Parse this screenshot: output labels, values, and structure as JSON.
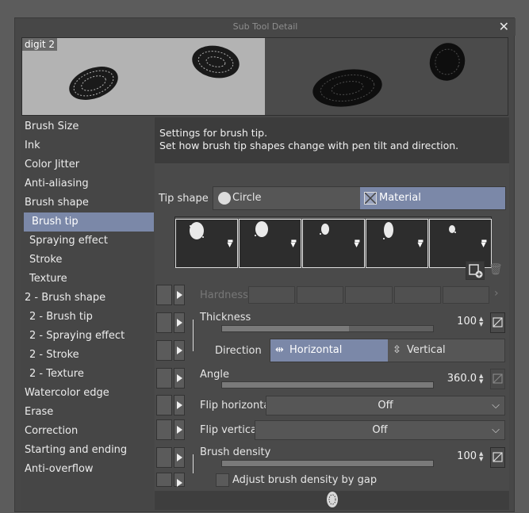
{
  "window": {
    "title": "Sub Tool Detail",
    "close": "✕"
  },
  "preview": {
    "name": "digit 2"
  },
  "sidebar": {
    "items": [
      {
        "label": "Brush Size",
        "sub": false,
        "selected": false
      },
      {
        "label": "Ink",
        "sub": false,
        "selected": false
      },
      {
        "label": "Color Jitter",
        "sub": false,
        "selected": false
      },
      {
        "label": "Anti-aliasing",
        "sub": false,
        "selected": false
      },
      {
        "label": "Brush shape",
        "sub": false,
        "selected": false
      },
      {
        "label": "Brush tip",
        "sub": true,
        "selected": true
      },
      {
        "label": "Spraying effect",
        "sub": true,
        "selected": false
      },
      {
        "label": "Stroke",
        "sub": true,
        "selected": false
      },
      {
        "label": "Texture",
        "sub": true,
        "selected": false
      },
      {
        "label": "2 - Brush shape",
        "sub": false,
        "selected": false
      },
      {
        "label": "2 - Brush tip",
        "sub": true,
        "selected": false
      },
      {
        "label": "2 - Spraying effect",
        "sub": true,
        "selected": false
      },
      {
        "label": "2 - Stroke",
        "sub": true,
        "selected": false
      },
      {
        "label": "2 - Texture",
        "sub": true,
        "selected": false
      },
      {
        "label": "Watercolor edge",
        "sub": false,
        "selected": false
      },
      {
        "label": "Erase",
        "sub": false,
        "selected": false
      },
      {
        "label": "Correction",
        "sub": false,
        "selected": false
      },
      {
        "label": "Starting and ending",
        "sub": false,
        "selected": false
      },
      {
        "label": "Anti-overflow",
        "sub": false,
        "selected": false
      }
    ]
  },
  "description": {
    "line1": "Settings for brush tip.",
    "line2": "Set how brush tip shapes change with pen tilt and direction."
  },
  "tip_shape": {
    "label": "Tip shape",
    "options": [
      "Circle",
      "Material"
    ],
    "selected": "Material"
  },
  "hardness": {
    "label": "Hardness"
  },
  "thickness": {
    "label": "Thickness",
    "value": "100",
    "fill": 0.6
  },
  "direction": {
    "label": "Direction",
    "options": [
      "Horizontal",
      "Vertical"
    ],
    "selected": "Horizontal"
  },
  "angle": {
    "label": "Angle",
    "value": "360.0",
    "fill": 1.0
  },
  "flip_horizontal": {
    "label": "Flip horizontal",
    "value": "Off"
  },
  "flip_vertical": {
    "label": "Flip vertical",
    "value": "Off"
  },
  "brush_density": {
    "label": "Brush density",
    "value": "100",
    "fill": 1.0
  },
  "adjust_density": {
    "label": "Adjust brush density by gap",
    "checked": false
  },
  "colors": {
    "accent": "#7b88a8",
    "panel": "#4a4a4a",
    "sidebar": "#464646"
  }
}
